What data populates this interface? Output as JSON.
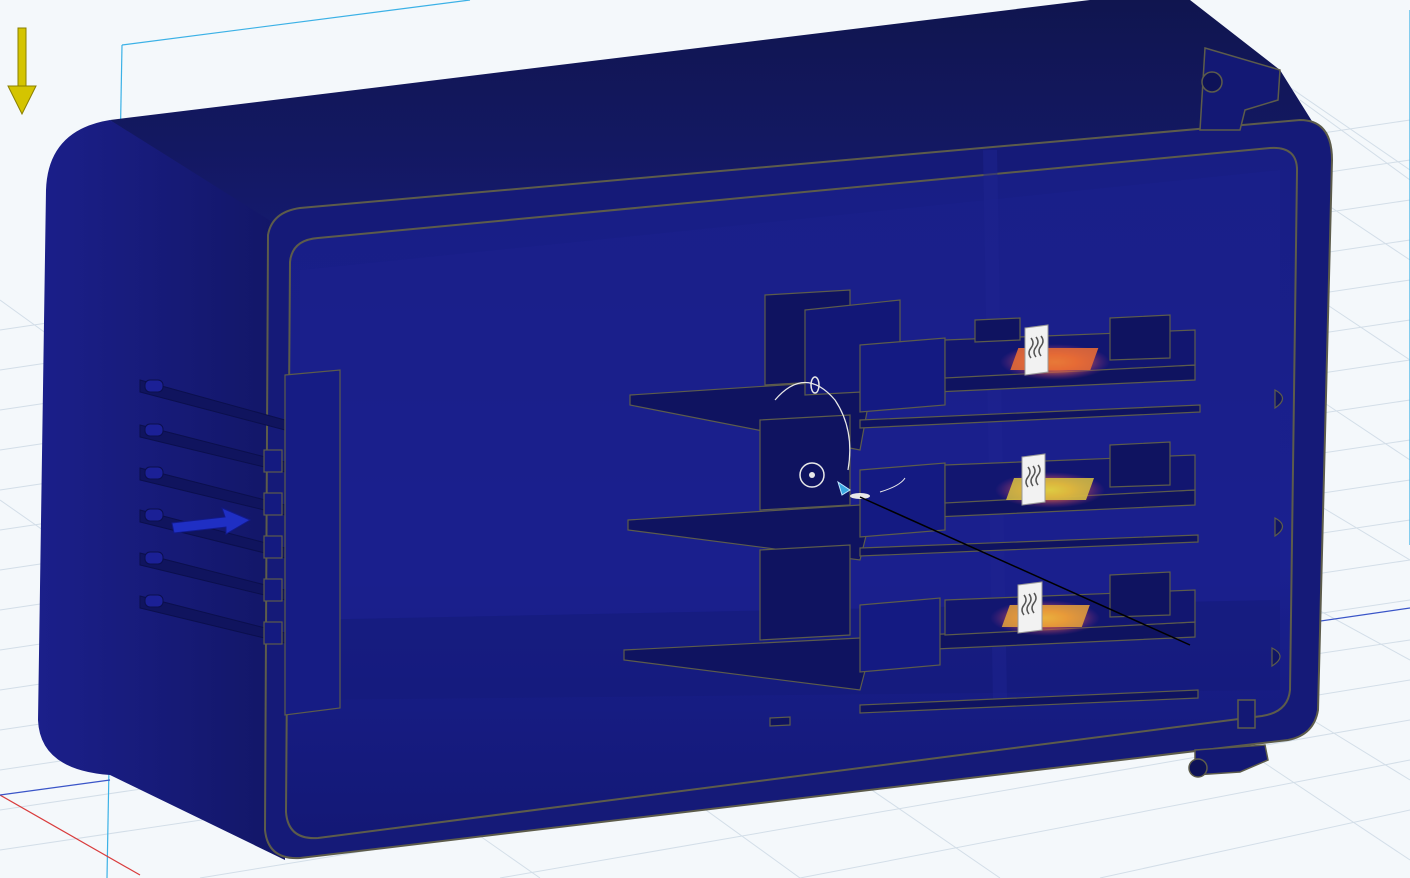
{
  "viewport": {
    "background": "#f4f8fb",
    "grid_color": "#cfdbe6",
    "view_cube_color": "#3bb1e6"
  },
  "model": {
    "enclosure_color": "#15197a",
    "enclosure_dark": "#0e1258",
    "outline_color": "#6b6a55"
  },
  "gravity_arrow": {
    "icon": "gravity-arrow-icon",
    "color": "#d4c400"
  },
  "flow_arrow": {
    "icon": "flow-inlet-arrow-icon",
    "color": "#1f2fc4"
  },
  "heat_sources": [
    {
      "icon": "heat-source-icon"
    },
    {
      "icon": "heat-source-icon"
    },
    {
      "icon": "heat-source-icon"
    }
  ],
  "manipulator": {
    "icon": "rotate-gizmo-icon",
    "accent": "#3aa7e0"
  },
  "heat_gradient": [
    "#f3ff52",
    "#e66a35",
    "#8a2a8a"
  ]
}
